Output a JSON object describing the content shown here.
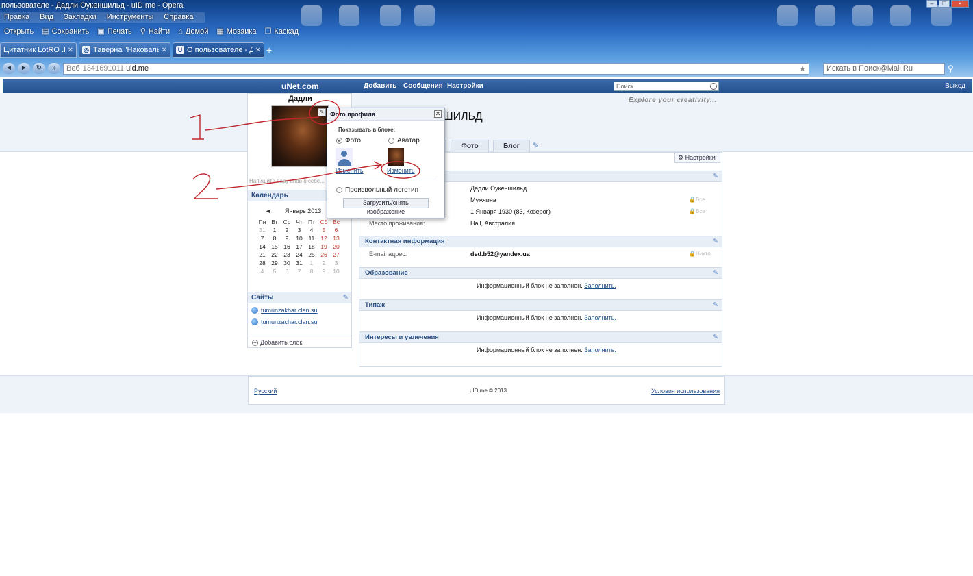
{
  "window": {
    "title": "пользователе - Дадли Оукеншильд - uID.me - Opera",
    "controls": [
      "–",
      "□",
      "×"
    ]
  },
  "menu": [
    "Правка",
    "Вид",
    "Закладки",
    "Инструменты",
    "Справка"
  ],
  "toolbar": [
    {
      "icon": "folder-icon",
      "glyph": "",
      "label": "Открыть"
    },
    {
      "icon": "save-icon",
      "glyph": "▤",
      "label": "Сохранить"
    },
    {
      "icon": "print-icon",
      "glyph": "▣",
      "label": "Печать"
    },
    {
      "icon": "find-icon",
      "glyph": "⚲",
      "label": "Найти"
    },
    {
      "icon": "home-icon",
      "glyph": "⌂",
      "label": "Домой"
    },
    {
      "icon": "tile-icon",
      "glyph": "▦",
      "label": "Мозаика"
    },
    {
      "icon": "cascade-icon",
      "glyph": "❐",
      "label": "Каскад"
    }
  ],
  "tabs": [
    {
      "label": "Цитатник LotRO .RU",
      "fav": "",
      "active": false
    },
    {
      "label": "Таверна \"Наковальн...",
      "fav": "◎",
      "active": false
    },
    {
      "label": "О пользователе - Дад...",
      "fav": "U",
      "active": true
    }
  ],
  "newtab": "+",
  "address": {
    "web_label": "Веб",
    "url_prefix": "1341691011.",
    "url": "uid.me"
  },
  "browser_search": {
    "placeholder": "Искать в Поиск@Mail.Ru"
  },
  "site": {
    "logo": "uNet.com",
    "nav": [
      "Добавить",
      "Сообщения",
      "Настройки"
    ],
    "search_placeholder": "Поиск",
    "logout": "Выход",
    "tagline": "Explore your creativity...",
    "hero_name_visible": "ШИЛЬД"
  },
  "profile_tabs": [
    "Фото",
    "Блог"
  ],
  "settings_button": "Настройки",
  "left": {
    "name": "Дадли",
    "status_placeholder": "Напишите пару слов о себе...",
    "calendar": {
      "title": "Календарь",
      "month": "Январь 2013",
      "prev": "◄",
      "days": [
        "Пн",
        "Вт",
        "Ср",
        "Чт",
        "Пт",
        "Сб",
        "Вс"
      ],
      "weeks": [
        [
          "31",
          "1",
          "2",
          "3",
          "4",
          "5",
          "6"
        ],
        [
          "7",
          "8",
          "9",
          "10",
          "11",
          "12",
          "13"
        ],
        [
          "14",
          "15",
          "16",
          "17",
          "18",
          "19",
          "20"
        ],
        [
          "21",
          "22",
          "23",
          "24",
          "25",
          "26",
          "27"
        ],
        [
          "28",
          "29",
          "30",
          "31",
          "1",
          "2",
          "3"
        ],
        [
          "4",
          "5",
          "6",
          "7",
          "8",
          "9",
          "10"
        ]
      ]
    },
    "sites_title": "Сайты",
    "sites": [
      "tumunzakhar.clan.su",
      "tumunzachar.clan.su"
    ],
    "add_block": "Добавить блок"
  },
  "popup": {
    "title": "Фото профиля",
    "show_in": "Показывать в блоке:",
    "option_photo": "Фото",
    "option_avatar": "Аватар",
    "change": "Изменить",
    "option_logo": "Произвольный логотип",
    "upload": "Загрузить/снять изображение"
  },
  "main": {
    "fields": [
      {
        "label": "",
        "value": "Дадли Оукеншильд",
        "vis": ""
      },
      {
        "label": "",
        "value": "Мужчина",
        "vis": "Все"
      },
      {
        "label": "",
        "value": "1 Января 1930 (83, Козерог)",
        "vis": "Все"
      },
      {
        "label": "Место проживания:",
        "value": "Hall, Австралия",
        "vis": ""
      }
    ],
    "contact_title": "Контактная информация",
    "email_label": "E-mail адрес:",
    "email": "ded.b52@yandex.ua",
    "email_vis": "Никто",
    "sections": [
      {
        "title": "Образование"
      },
      {
        "title": "Типаж"
      },
      {
        "title": "Интересы и увлечения"
      }
    ],
    "empty_text": "Информационный блок не заполнен.",
    "fill_link": "Заполнить."
  },
  "footer": {
    "lang": "Русский",
    "copyright": "uID.me © 2013",
    "terms": "Условия использования"
  },
  "annotations": {
    "one": "1",
    "two": "2"
  }
}
